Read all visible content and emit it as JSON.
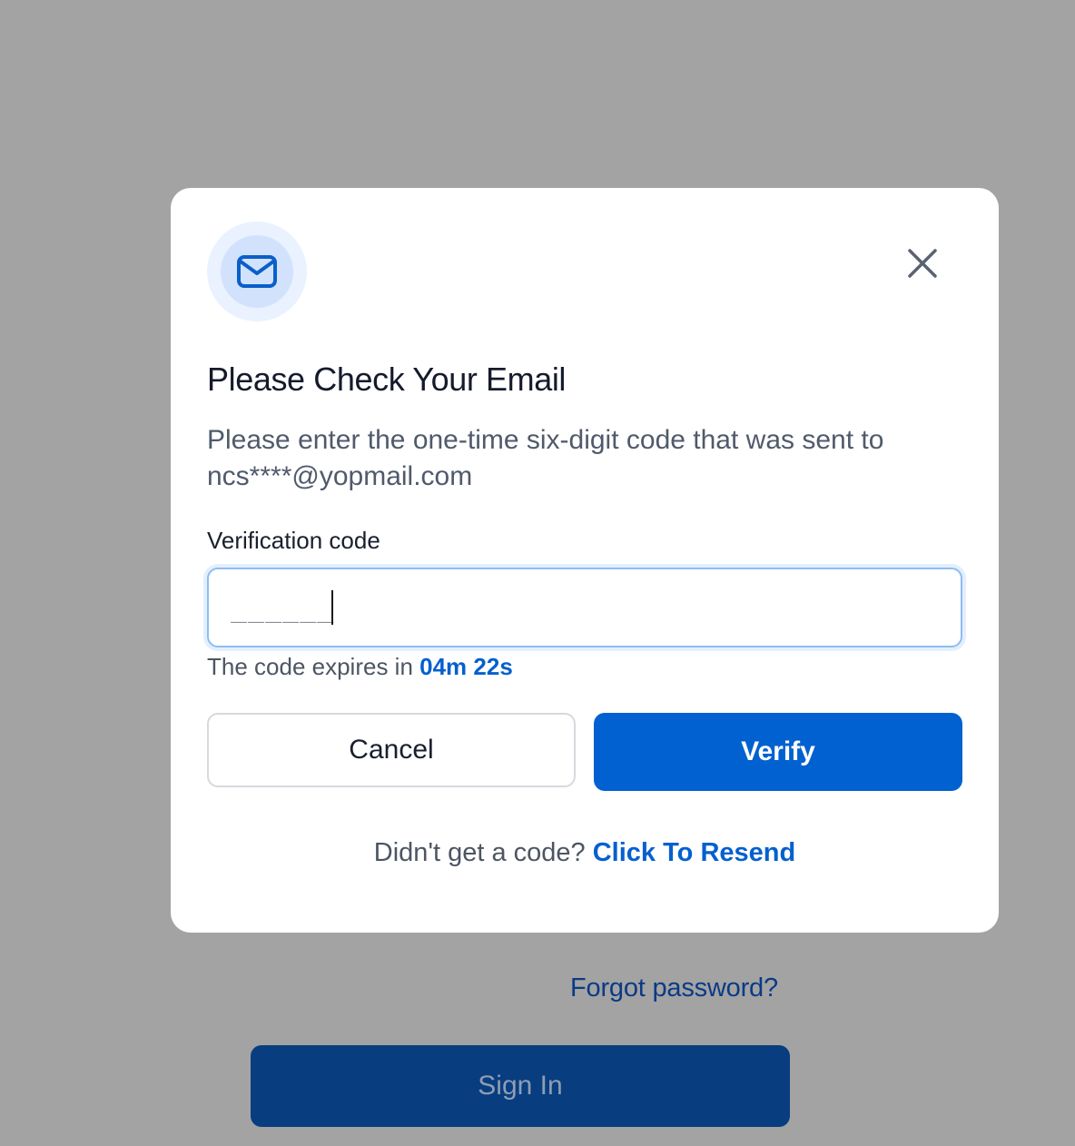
{
  "background": {
    "forgot_password": "Forgot password?",
    "sign_in": "Sign In"
  },
  "modal": {
    "icon": "mail-icon",
    "close_icon": "close-icon",
    "title": "Please Check Your Email",
    "description_line1": "Please enter the one-time six-digit code that was sent to",
    "description_line2": "ncs****@yopmail.com",
    "field_label": "Verification code",
    "input_placeholder": "______",
    "input_value": "",
    "expiry_prefix": "The code expires in",
    "expiry_timer": "04m 22s",
    "cancel_label": "Cancel",
    "verify_label": "Verify",
    "resend_prompt": "Didn't get a code?",
    "resend_link": "Click To Resend"
  },
  "colors": {
    "accent": "#0161d0",
    "overlay": "#a3a3a3",
    "background_button": "#083d80"
  }
}
